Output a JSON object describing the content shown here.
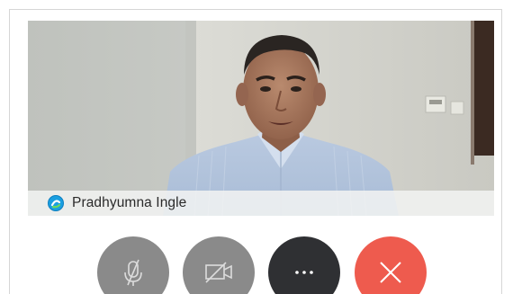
{
  "participant": {
    "name": "Pradhyumna Ingle",
    "presence_icon": "presence-status-icon",
    "presence_color": "#1a9fe0"
  },
  "controls": [
    {
      "id": "mute",
      "icon": "microphone-muted-icon",
      "color": "#8a8a8a"
    },
    {
      "id": "video",
      "icon": "camera-off-icon",
      "color": "#8a8a8a"
    },
    {
      "id": "more",
      "icon": "more-options-icon",
      "color": "#2f3033"
    },
    {
      "id": "end",
      "icon": "end-call-icon",
      "color": "#ee5b4e"
    }
  ]
}
